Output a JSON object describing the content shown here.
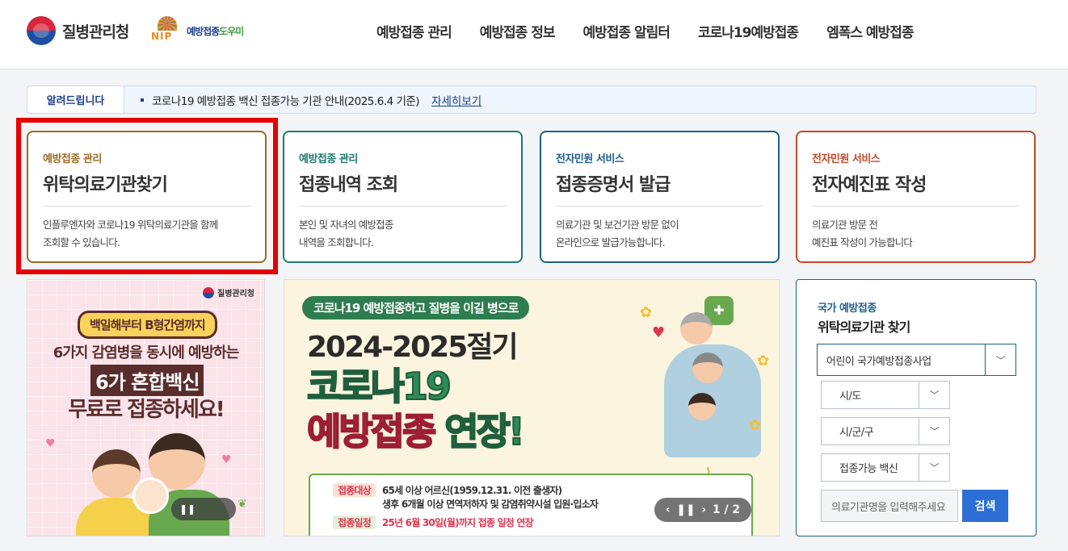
{
  "header": {
    "kdca_logo": "질병관리청",
    "nip_logo_letters": "NIP",
    "nip_logo_text_a": "예방접종",
    "nip_logo_text_b": "도우미",
    "nav": [
      "예방접종 관리",
      "예방접종 정보",
      "예방접종 알림터",
      "코로나19예방접종",
      "엠폭스 예방접종"
    ]
  },
  "notice": {
    "label": "알려드립니다",
    "text": "코로나19 예방접종 백신 접종가능 기관 안내(2025.6.4 기준)",
    "more": "자세히보기"
  },
  "cards": [
    {
      "category": "예방접종 관리",
      "title": "위탁의료기관찾기",
      "desc1": "인플루엔자와 코로나19 위탁의료기관을 함께",
      "desc2": "조회할 수 있습니다."
    },
    {
      "category": "예방접종 관리",
      "title": "접종내역 조회",
      "desc1": "본인 및 자녀의 예방접종",
      "desc2": "내역을 조회합니다."
    },
    {
      "category": "전자민원 서비스",
      "title": "접종증명서 발급",
      "desc1": "의료기관 및 보건기관 방문 없이",
      "desc2": "온라인으로 발급가능합니다."
    },
    {
      "category": "전자민원 서비스",
      "title": "전자예진표 작성",
      "desc1": "의료기관 방문 전",
      "desc2": "예진표 작성이 가능합니다"
    }
  ],
  "banner_left": {
    "logo": "질병관리청",
    "pill": "백일해부터 B형간염까지",
    "line1": "6가지 감염병을 동시에 예방하는",
    "line2": "6가 혼합백신",
    "line3": "무료로 접종하세요!",
    "pause": "❚❚"
  },
  "banner_center": {
    "pill": "코로나19 예방접종하고 질병을 이길 병으로",
    "season": "2024-2025절기",
    "covid": "코로나19",
    "ext_red": "예방접종",
    "ext_green": "연장!",
    "target_tag": "접종대상",
    "target_line1": "65세 이상 어르신(1959.12.31. 이전 출생자)",
    "target_line2a": "생후 6개월 이상 ",
    "target_line2b": "면역저하자 및 감염취약시설 입원·입소자",
    "schedule_tag": "접종일정",
    "schedule_text": "25년 6월 30일(월)까지 접종 일정 연장",
    "ctrl_prev": "‹",
    "ctrl_pause": "❚❚",
    "ctrl_next": "›",
    "ctrl_page": "1 / 2"
  },
  "search": {
    "category": "국가 예방접종",
    "title": "위탁의료기관 찾기",
    "program": "어린이 국가예방접종사업",
    "sido": "시/도",
    "sigungu": "시/군/구",
    "vaccine": "접종가능 백신",
    "input_placeholder": "의료기관명을 입력해주세요",
    "button": "검색"
  },
  "colors": {
    "highlight": "#e60000",
    "primary": "#1e5f8c",
    "search_button": "#2c6ed5"
  }
}
